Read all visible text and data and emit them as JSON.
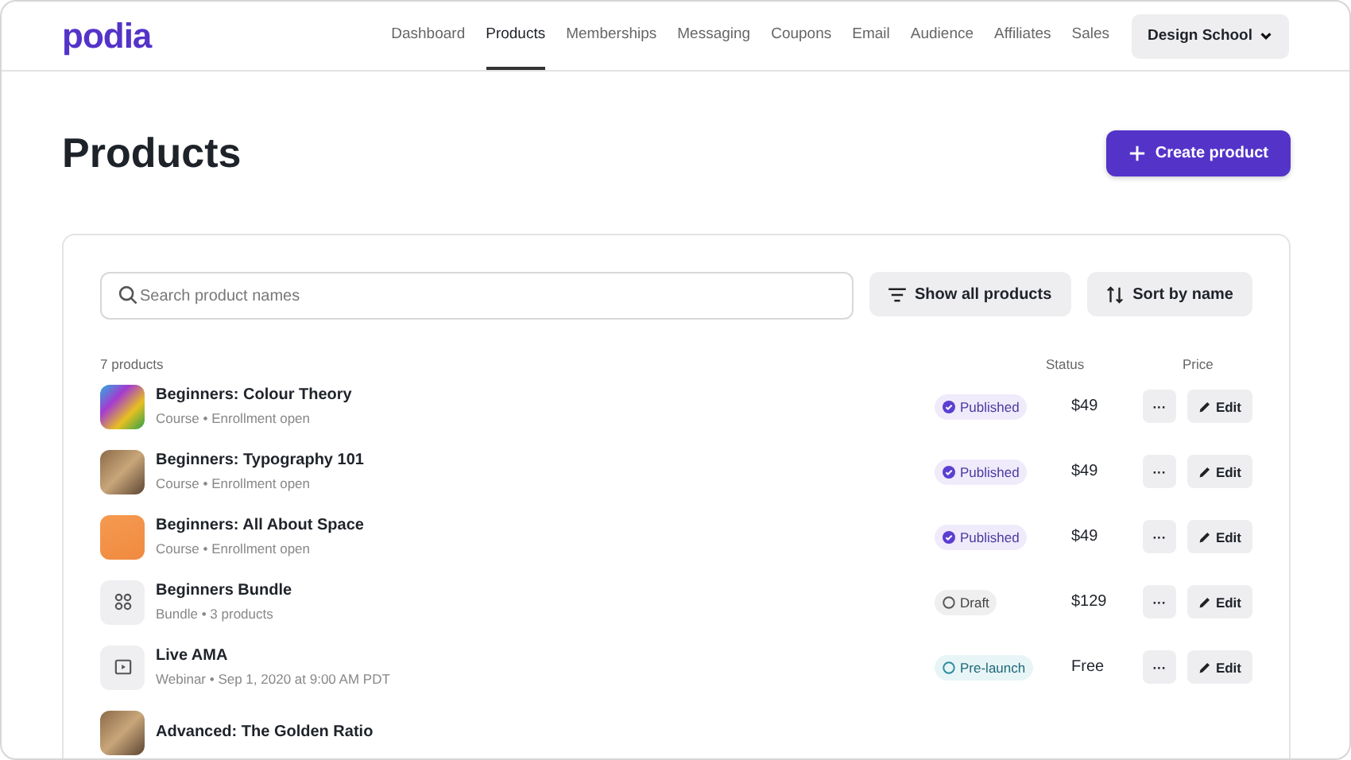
{
  "brand": {
    "name": "podia"
  },
  "nav": [
    {
      "label": "Dashboard",
      "selected": false
    },
    {
      "label": "Products",
      "selected": true
    },
    {
      "label": "Memberships",
      "selected": false
    },
    {
      "label": "Messaging",
      "selected": false
    },
    {
      "label": "Coupons",
      "selected": false
    },
    {
      "label": "Email",
      "selected": false
    },
    {
      "label": "Audience",
      "selected": false
    },
    {
      "label": "Affiliates",
      "selected": false
    },
    {
      "label": "Sales",
      "selected": false
    }
  ],
  "account_menu": {
    "label": "Design School"
  },
  "page": {
    "title": "Products",
    "create_button": "Create product"
  },
  "toolbar": {
    "search": {
      "placeholder": "Search product names"
    },
    "filter_button": "Show all products",
    "sort_button": "Sort by name"
  },
  "table": {
    "count": "7 products",
    "columns": [
      "Status",
      "Price"
    ],
    "rows": [
      {
        "thumb": {
          "kind": "photo"
        },
        "name": "Beginners: Colour Theory",
        "meta": "Course • Enrollment open",
        "status": {
          "kind": "published",
          "label": "Published"
        },
        "price": "$49",
        "more": "···",
        "edit": "Edit"
      },
      {
        "thumb": {
          "kind": "photo"
        },
        "name": "Beginners: Typography 101",
        "meta": "Course • Enrollment open",
        "status": {
          "kind": "published",
          "label": "Published"
        },
        "price": "$49",
        "more": "···",
        "edit": "Edit"
      },
      {
        "thumb": {
          "kind": "photo"
        },
        "name": "Beginners: All About Space",
        "meta": "Course • Enrollment open",
        "status": {
          "kind": "published",
          "label": "Published"
        },
        "price": "$49",
        "more": "···",
        "edit": "Edit"
      },
      {
        "thumb": {
          "kind": "bundle"
        },
        "name": "Beginners Bundle",
        "meta": "Bundle • 3 products",
        "status": {
          "kind": "draft",
          "label": "Draft"
        },
        "price": "$129",
        "more": "···",
        "edit": "Edit"
      },
      {
        "thumb": {
          "kind": "webinar"
        },
        "name": "Live AMA",
        "meta": "Webinar • Sep 1, 2020 at 9:00 AM PDT",
        "status": {
          "kind": "prelaunch",
          "label": "Pre-launch"
        },
        "price": "Free",
        "more": "···",
        "edit": "Edit"
      },
      {
        "thumb": {
          "kind": "photo"
        },
        "name": "Advanced: The Golden Ratio"
      }
    ]
  }
}
